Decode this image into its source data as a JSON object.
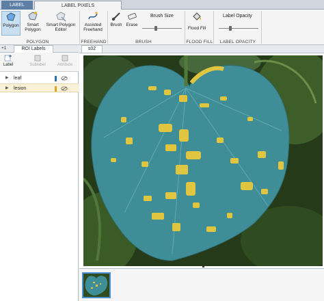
{
  "tabs": [
    "LABEL",
    "LABEL PIXELS"
  ],
  "ribbon": {
    "polygon_tool": "Polygon",
    "smart_polygon": "Smart Polygon",
    "smart_polygon_editor": "Smart Polygon Editor",
    "assisted_freehand": "Assisted Freehand",
    "brush": "Brush",
    "erase": "Erase",
    "brush_size": "Brush Size",
    "flood_fill": "Flood Fill",
    "label_opacity": "Label Opacity",
    "brush_size_level": 0.35,
    "label_opacity_level": 0.3,
    "sections": [
      "POLYGON",
      "FREEHAND",
      "BRUSH",
      "FLOOD FILL",
      "LABEL OPACITY"
    ]
  },
  "left_panel": {
    "plus": "+1",
    "tab": "ROI Labels",
    "tools": [
      "Label",
      "Sublabel",
      "Attribute"
    ],
    "labels": [
      {
        "name": "leaf",
        "color": "#2b6fb0",
        "selected": false
      },
      {
        "name": "lesion",
        "color": "#d4a62a",
        "selected": true
      }
    ]
  },
  "image_panel": {
    "tab": "s02"
  },
  "colors": {
    "accent": "#5d7fa6",
    "leaf_overlay": "#3f8e97",
    "lesion_overlay": "#e0c640",
    "background_foliage": "#2f4a1e"
  }
}
